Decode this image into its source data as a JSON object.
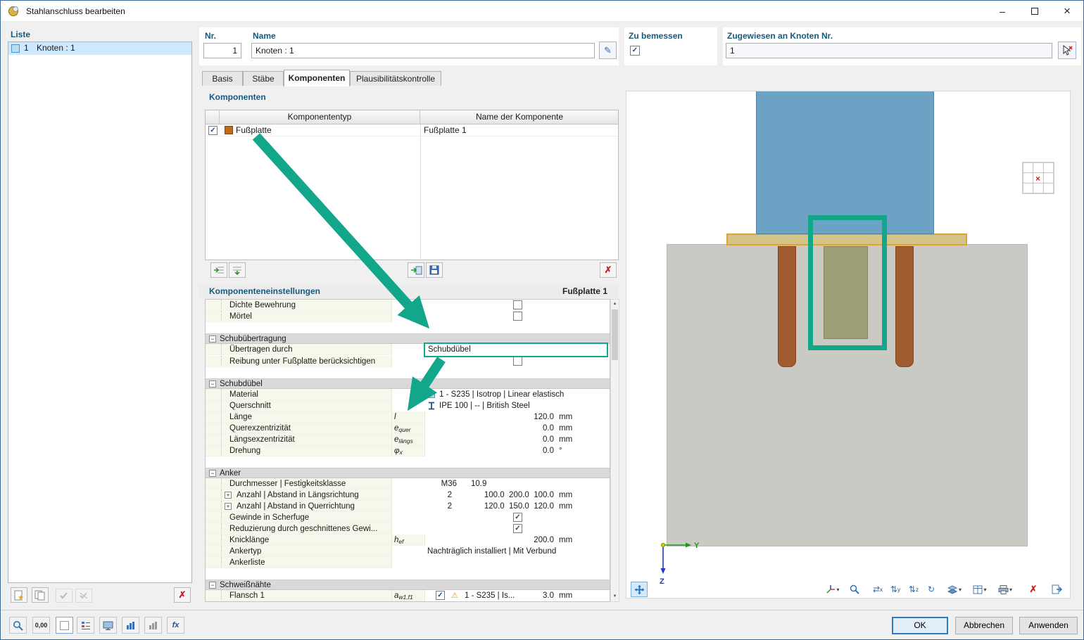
{
  "colors": {
    "annotation_teal": "#12a68b",
    "selection_blue": "#cde8ff",
    "label_blue": "#155a7e",
    "component_swatch": "#c06a1e",
    "column_blue": "#6ca3c5",
    "plate_tan": "#d4c488",
    "concrete_gray": "#cac9c3",
    "anchor_brown": "#a05c30"
  },
  "titlebar": {
    "title": "Stahlanschluss bearbeiten"
  },
  "glyphs": {
    "minimize": "–",
    "close": "×",
    "pencil": "✎",
    "red_x": "✗",
    "warning": "⚠",
    "dropdown": "▾",
    "minus": "−",
    "plus": "+",
    "up": "▲",
    "down": "▼",
    "arrows_h": "⇄",
    "arrows_v": "⇅",
    "rotate": "↻",
    "nav_x": "×",
    "star": "★",
    "axis_x": "x",
    "axis_y": "y",
    "axis_z": "z"
  },
  "liste": {
    "label": "Liste",
    "item_num": "1",
    "item_name": "Knoten : 1"
  },
  "header": {
    "nr_label": "Nr.",
    "nr_value": "1",
    "name_label": "Name",
    "name_value": "Knoten : 1",
    "zu_bemessen": "Zu bemessen",
    "zugewiesen_label": "Zugewiesen an Knoten Nr.",
    "zugewiesen_value": "1"
  },
  "tabs": {
    "basis": "Basis",
    "staebe": "Stäbe",
    "komponenten": "Komponenten",
    "plausi": "Plausibilitätskontrolle"
  },
  "komponenten": {
    "title": "Komponenten",
    "col_typ": "Komponententyp",
    "col_name": "Name der Komponente",
    "row_typ": "Fußplatte",
    "row_name": "Fußplatte 1"
  },
  "einstellungen": {
    "title": "Komponenteneinstellungen",
    "target": "Fußplatte 1",
    "dichte_bewehrung": "Dichte Bewehrung",
    "moertel": "Mörtel",
    "sec_schubuebertragung": "Schubübertragung",
    "uebertragen_durch": "Übertragen durch",
    "uebertragen_value": "Schubdübel",
    "reibung": "Reibung unter Fußplatte berücksichtigen",
    "sec_schubduebel": "Schubdübel",
    "material": "Material",
    "material_value": "1 - S235 | Isotrop | Linear elastisch",
    "querschnitt": "Querschnitt",
    "querschnitt_value": "IPE 100 | -- | British Steel",
    "laenge": "Länge",
    "laenge_sym": "l",
    "laenge_value": "120.0",
    "laenge_unit": "mm",
    "querex": "Querexzentrizität",
    "querex_sym": "e",
    "querex_sub": "quer",
    "querex_value": "0.0",
    "querex_unit": "mm",
    "laengsex": "Längsexzentrizität",
    "laengsex_sym": "e",
    "laengsex_sub": "längs",
    "laengsex_value": "0.0",
    "laengsex_unit": "mm",
    "drehung": "Drehung",
    "drehung_sym": "φ",
    "drehung_sub": "x",
    "drehung_value": "0.0",
    "drehung_unit": "°",
    "sec_anker": "Anker",
    "durchmesser": "Durchmesser | Festigkeitsklasse",
    "durchmesser_v1": "M36",
    "durchmesser_v2": "10.9",
    "anz_laengs": "Anzahl | Abstand in Längsrichtung",
    "anz_laengs_n": "2",
    "anz_laengs_v": "100.0  200.0  100.0",
    "anz_laengs_unit": "mm",
    "anz_quer": "Anzahl | Abstand in Querrichtung",
    "anz_quer_n": "2",
    "anz_quer_v": "120.0  150.0  120.0",
    "anz_quer_unit": "mm",
    "gewinde": "Gewinde in Scherfuge",
    "reduzierung": "Reduzierung durch geschnittenes Gewi...",
    "knicklaenge": "Knicklänge",
    "knick_sym": "h",
    "knick_sub": "ef",
    "knick_value": "200.0",
    "knick_unit": "mm",
    "ankertyp": "Ankertyp",
    "ankertyp_value": "Nachträglich installiert | Mit Verbund",
    "ankerliste": "Ankerliste",
    "sec_schweissnaehte": "Schweißnähte",
    "flansch": "Flansch 1",
    "flansch_sym": "a",
    "flansch_sub": "w1,f1",
    "flansch_value": "1 - S235 | Is...",
    "flansch_num": "3.0",
    "flansch_unit": "mm"
  },
  "checks": {
    "zu_bemessen": "✓",
    "komponente_row": "✓",
    "dichte_bewehrung": "",
    "moertel": "",
    "reibung": "",
    "gewinde": "✓",
    "reduzierung": "✓",
    "flansch": "✓"
  },
  "viewport": {
    "axis_y": "Y",
    "axis_z": "Z"
  },
  "bottom": {
    "decimals": "0,00",
    "formula": "fx",
    "ok": "OK",
    "cancel": "Abbrechen",
    "apply": "Anwenden"
  }
}
